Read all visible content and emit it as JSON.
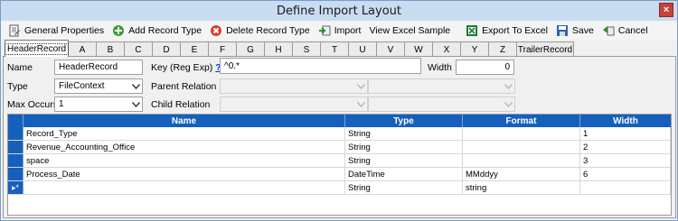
{
  "window": {
    "title": "Define Import Layout",
    "close_glyph": "×"
  },
  "toolbar": {
    "general_properties": "General Properties",
    "add_record_type": "Add Record Type",
    "delete_record_type": "Delete Record Type",
    "import": "Import",
    "view_excel_sample": "View Excel Sample",
    "export_to_excel": "Export To Excel",
    "save": "Save",
    "cancel": "Cancel"
  },
  "tabs": [
    "HeaderRecord",
    "A",
    "B",
    "C",
    "D",
    "E",
    "F",
    "G",
    "H",
    "S",
    "T",
    "U",
    "V",
    "W",
    "X",
    "Y",
    "Z",
    "TrailerRecord"
  ],
  "active_tab": "HeaderRecord",
  "form": {
    "name_label": "Name",
    "name_value": "HeaderRecord",
    "key_label": "Key (Reg Exp)",
    "key_help": "?",
    "key_value": "^0.*",
    "width_label": "Width",
    "width_value": "0",
    "type_label": "Type",
    "type_value": "FileContext",
    "parent_label": "Parent Relation",
    "max_occurs_label": "Max Occurs",
    "max_occurs_value": "1",
    "child_label": "Child Relation"
  },
  "grid": {
    "columns": [
      "Name",
      "Type",
      "Format",
      "Width"
    ],
    "rows": [
      {
        "name": "Record_Type",
        "type": "String",
        "format": "",
        "width": "1"
      },
      {
        "name": "Revenue_Accounting_Office",
        "type": "String",
        "format": "",
        "width": "2"
      },
      {
        "name": "space",
        "type": "String",
        "format": "",
        "width": "3"
      },
      {
        "name": "Process_Date",
        "type": "DateTime",
        "format": "MMddyy",
        "width": "6"
      },
      {
        "name": "",
        "type": "String",
        "format": "string",
        "width": ""
      }
    ],
    "new_row_marker": "▸*"
  },
  "colors": {
    "grid_header": "#1560bd",
    "titlebar": "#c9dcf2",
    "close": "#c7423a"
  }
}
